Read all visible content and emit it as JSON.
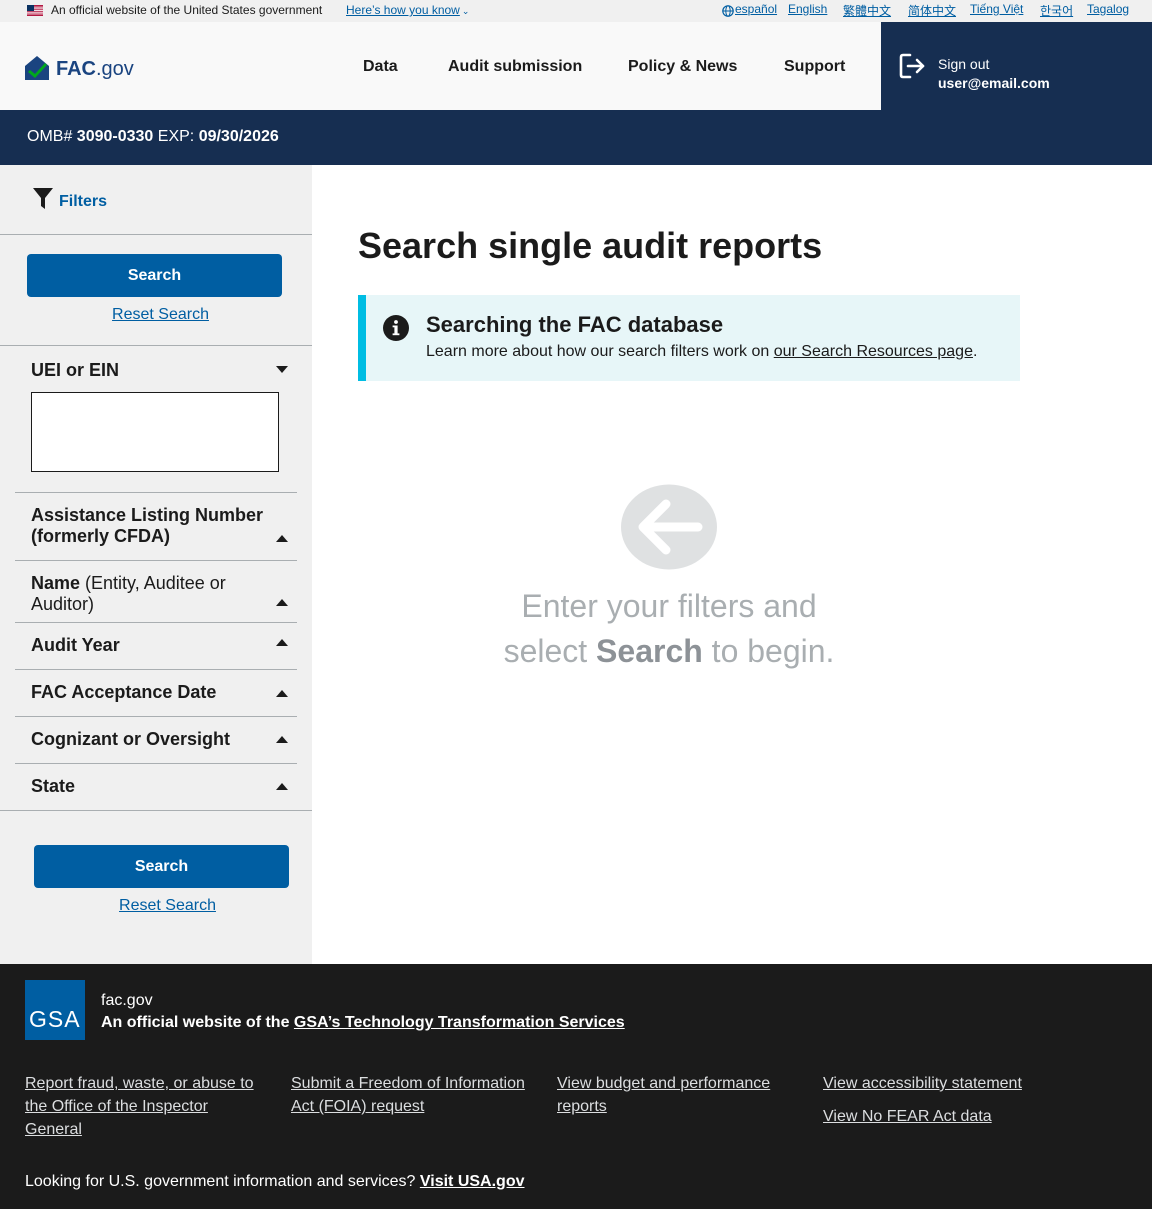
{
  "gov_banner": {
    "text": "An official website of the United States government",
    "link": "Here’s how you know",
    "languages": [
      "español",
      "English",
      "繁體中文",
      "简体中文",
      "Tiếng Việt",
      "한국어",
      "Tagalog"
    ]
  },
  "header": {
    "logo_main": "FAC",
    "logo_suffix": ".gov",
    "nav": [
      "Data",
      "Audit submission",
      "Policy & News",
      "Support"
    ],
    "signout_label": "Sign out",
    "user_email": "user@email.com"
  },
  "omb": {
    "label": "OMB#",
    "number": "3090-0330",
    "exp_label": "EXP:",
    "exp_date": "09/30/2026"
  },
  "sidebar": {
    "filters_label": "Filters",
    "search_button": "Search",
    "reset_link": "Reset Search",
    "filters": {
      "uei": "UEI or EIN",
      "aln_line1": "Assistance Listing Number",
      "aln_line2": "(formerly CFDA)",
      "name_bold": "Name",
      "name_rest_line1": " (Entity, Auditee or",
      "name_rest_line2": "Auditor)",
      "audit_year": "Audit Year",
      "acceptance_date": "FAC Acceptance Date",
      "cognizant": "Cognizant or Oversight",
      "state": "State"
    },
    "uei_value": ""
  },
  "main": {
    "title": "Search single audit reports",
    "alert_heading": "Searching the FAC database",
    "alert_body_prefix": "Learn more about how our search filters work on ",
    "alert_body_link": "our Search Resources page",
    "alert_body_suffix": ".",
    "empty_line1": "Enter your filters and",
    "empty_line2_prefix": "select ",
    "empty_line2_bold": "Search",
    "empty_line2_suffix": " to begin."
  },
  "footer": {
    "logo_text": "GSA",
    "domain": "fac.gov",
    "official_prefix": "An official website of the ",
    "official_link": "GSA’s Technology Transformation Services",
    "links": {
      "fraud_1": "Report fraud, waste, or abuse to",
      "fraud_2": "the Office of the Inspector",
      "fraud_3": "General",
      "foia_1": "Submit a Freedom of Information",
      "foia_2": "Act (FOIA) request",
      "budget_1": "View budget and performance",
      "budget_2": "reports",
      "accessibility": "View accessibility statement",
      "nofear": "View No FEAR Act data"
    },
    "bottom_prefix": "Looking for U.S. government information and services? ",
    "bottom_link": "Visit USA.gov"
  },
  "colors": {
    "primary": "#005ea2",
    "navy": "#162e51",
    "alert_bg": "#e7f6f8",
    "alert_border": "#00bde3",
    "footer_bg": "#1b1b1b"
  }
}
